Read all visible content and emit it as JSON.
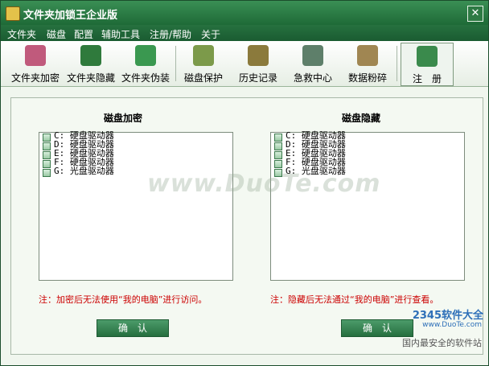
{
  "window": {
    "title": "文件夹加锁王企业版"
  },
  "menu": [
    "文件夹",
    "磁盘",
    "配置",
    "辅助工具",
    "注册/帮助",
    "关于"
  ],
  "toolbar": [
    {
      "label": "文件夹加密",
      "icon": "folder-lock-icon",
      "color": "#c05a7c"
    },
    {
      "label": "文件夹隐藏",
      "icon": "question-mark-icon",
      "color": "#2f7a3c"
    },
    {
      "label": "文件夹伪装",
      "icon": "floppy-disk-icon",
      "color": "#3a9850"
    },
    {
      "label": "磁盘保护",
      "icon": "disk-protect-icon",
      "color": "#7c9a4a"
    },
    {
      "label": "历史记录",
      "icon": "history-icon",
      "color": "#8b7a3c"
    },
    {
      "label": "急救中心",
      "icon": "rescue-icon",
      "color": "#5e7f6a"
    },
    {
      "label": "数据粉碎",
      "icon": "shredder-icon",
      "color": "#a08652"
    },
    {
      "label": "注　册",
      "icon": "register-icon",
      "color": "#3a8a4c"
    }
  ],
  "encrypt": {
    "title": "磁盘加密",
    "drives": [
      "C: 硬盘驱动器",
      "D: 硬盘驱动器",
      "E: 硬盘驱动器",
      "F: 硬盘驱动器",
      "G: 光盘驱动器"
    ],
    "note": "注：加密后无法使用“我的电脑”进行访问。",
    "button": "确　认"
  },
  "hide": {
    "title": "磁盘隐藏",
    "drives": [
      "C: 硬盘驱动器",
      "D: 硬盘驱动器",
      "E: 硬盘驱动器",
      "F: 硬盘驱动器",
      "G: 光盘驱动器"
    ],
    "note": "注：隐藏后无法通过“我的电脑”进行查看。",
    "button": "确　认"
  },
  "watermark": {
    "site": "www.DuoTe.com",
    "logo": "2345软件大全",
    "url": "www.DuoTe.com",
    "slogan": "国内最安全的软件站"
  },
  "close_glyph": "✕"
}
